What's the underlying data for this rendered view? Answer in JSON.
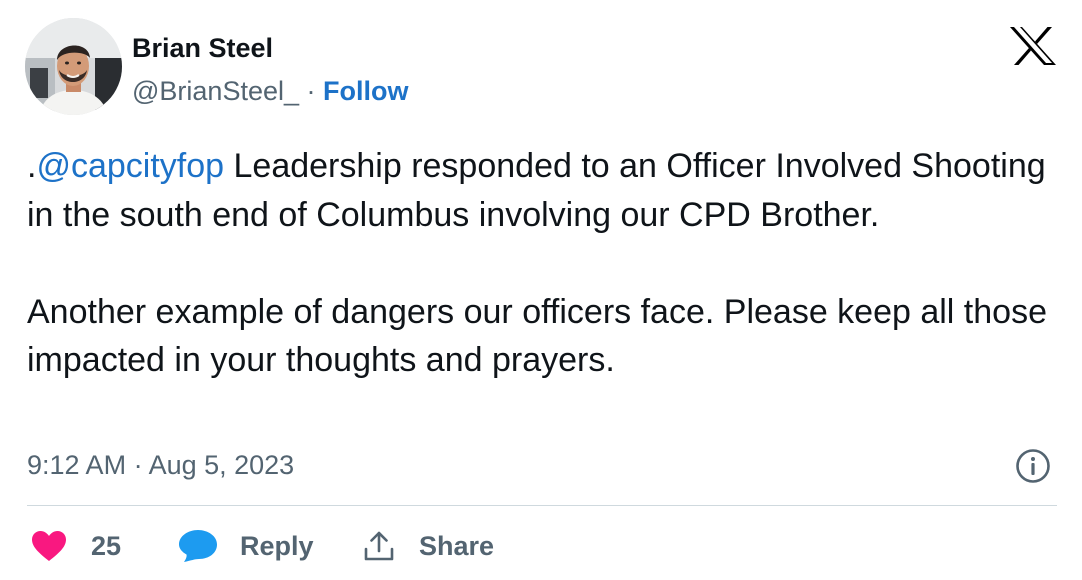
{
  "author": {
    "name": "Brian Steel",
    "handle": "@BrianSteel_",
    "separator": "·",
    "follow_label": "Follow"
  },
  "platform_icon": "x-logo-icon",
  "tweet": {
    "prefix": ".",
    "mention": "@capcityfop",
    "paragraph1_rest": " Leadership responded to an Officer Involved Shooting in the south end of Columbus involving our CPD Brother.",
    "paragraph2": "Another example of dangers our officers face.  Please keep all those impacted in your thoughts and prayers.",
    "timestamp": "9:12 AM · Aug 5, 2023"
  },
  "actions": {
    "like_count": "25",
    "reply_label": "Reply",
    "share_label": "Share"
  },
  "icons": {
    "like": "heart-icon",
    "reply": "speech-bubble-icon",
    "share": "share-upload-icon",
    "info": "info-circle-icon"
  },
  "colors": {
    "link": "#1d72c8",
    "secondary_text": "#536471",
    "primary_text": "#0f1419",
    "like_heart": "#f91880",
    "reply_bubble": "#1d9bf0",
    "divider": "#cfd9de"
  }
}
